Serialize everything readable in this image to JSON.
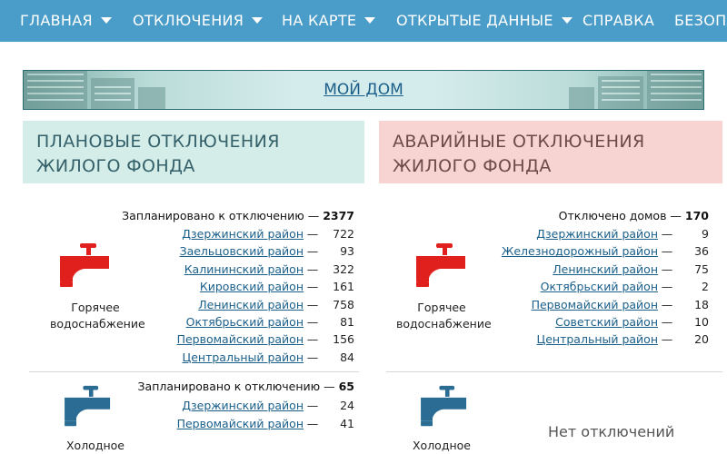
{
  "nav": {
    "items": [
      {
        "label": "ГЛАВНАЯ",
        "has_dropdown": true
      },
      {
        "label": "ОТКЛЮЧЕНИЯ",
        "has_dropdown": true
      },
      {
        "label": "НА КАРТЕ",
        "has_dropdown": true
      },
      {
        "label": "ОТКРЫТЫЕ ДАННЫЕ",
        "has_dropdown": true
      },
      {
        "label": "СПРАВКА",
        "has_dropdown": false
      },
      {
        "label": "БЕЗОПА",
        "has_dropdown": false
      }
    ],
    "color": "#4a9cc9"
  },
  "banner": {
    "link": "МОЙ ДОМ"
  },
  "planned": {
    "title": "ПЛАНОВЫЕ ОТКЛЮЧЕНИЯ ЖИЛОГО ФОНДА",
    "hot": {
      "caption": "Горячее водоснабжение",
      "summary_label": "Запланировано к отключению —",
      "summary_value": "2377",
      "rows": [
        {
          "district": "Дзержинский район",
          "count": "722"
        },
        {
          "district": "Заельцовский район",
          "count": "93"
        },
        {
          "district": "Калининский район",
          "count": "322"
        },
        {
          "district": "Кировский район",
          "count": "161"
        },
        {
          "district": "Ленинский район",
          "count": "758"
        },
        {
          "district": "Октябрьский район",
          "count": "81"
        },
        {
          "district": "Первомайский район",
          "count": "156"
        },
        {
          "district": "Центральный район",
          "count": "84"
        }
      ]
    },
    "cold": {
      "caption": "Холодное",
      "summary_label": "Запланировано к отключению —",
      "summary_value": "65",
      "rows": [
        {
          "district": "Дзержинский район",
          "count": "24"
        },
        {
          "district": "Первомайский район",
          "count": "41"
        }
      ]
    }
  },
  "emergency": {
    "title": "АВАРИЙНЫЕ ОТКЛЮЧЕНИЯ ЖИЛОГО ФОНДА",
    "hot": {
      "caption": "Горячее водоснабжение",
      "summary_label": "Отключено домов —",
      "summary_value": "170",
      "rows": [
        {
          "district": "Дзержинский район",
          "count": "9"
        },
        {
          "district": "Железнодорожный район",
          "count": "36"
        },
        {
          "district": "Ленинский район",
          "count": "75"
        },
        {
          "district": "Октябрьский район",
          "count": "2"
        },
        {
          "district": "Первомайский район",
          "count": "18"
        },
        {
          "district": "Советский район",
          "count": "10"
        },
        {
          "district": "Центральный район",
          "count": "20"
        }
      ]
    },
    "cold": {
      "caption": "Холодное",
      "none_text": "Нет отключений"
    }
  },
  "colors": {
    "hot_tap": "#e0201c",
    "cold_tap": "#2a6c93",
    "link": "#1a5f8a"
  },
  "icons": {
    "hot": "red-water-tap-icon",
    "cold": "blue-water-tap-icon"
  }
}
